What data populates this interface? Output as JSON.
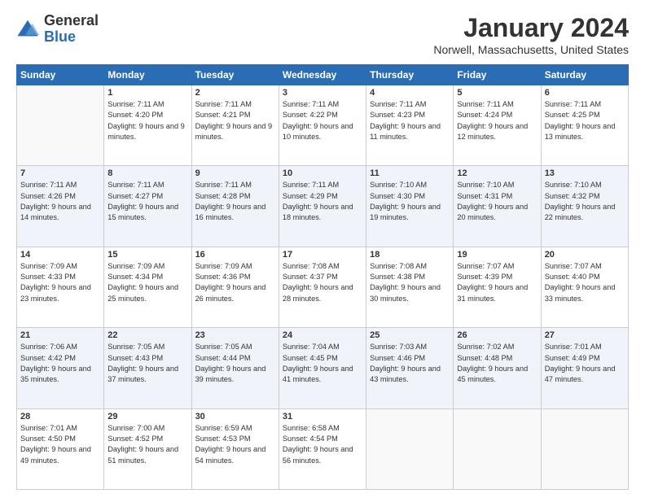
{
  "header": {
    "logo_general": "General",
    "logo_blue": "Blue",
    "month_year": "January 2024",
    "location": "Norwell, Massachusetts, United States"
  },
  "days_of_week": [
    "Sunday",
    "Monday",
    "Tuesday",
    "Wednesday",
    "Thursday",
    "Friday",
    "Saturday"
  ],
  "weeks": [
    [
      {
        "day": "",
        "sunrise": "",
        "sunset": "",
        "daylight": "",
        "empty": true
      },
      {
        "day": "1",
        "sunrise": "Sunrise: 7:11 AM",
        "sunset": "Sunset: 4:20 PM",
        "daylight": "Daylight: 9 hours and 9 minutes.",
        "empty": false
      },
      {
        "day": "2",
        "sunrise": "Sunrise: 7:11 AM",
        "sunset": "Sunset: 4:21 PM",
        "daylight": "Daylight: 9 hours and 9 minutes.",
        "empty": false
      },
      {
        "day": "3",
        "sunrise": "Sunrise: 7:11 AM",
        "sunset": "Sunset: 4:22 PM",
        "daylight": "Daylight: 9 hours and 10 minutes.",
        "empty": false
      },
      {
        "day": "4",
        "sunrise": "Sunrise: 7:11 AM",
        "sunset": "Sunset: 4:23 PM",
        "daylight": "Daylight: 9 hours and 11 minutes.",
        "empty": false
      },
      {
        "day": "5",
        "sunrise": "Sunrise: 7:11 AM",
        "sunset": "Sunset: 4:24 PM",
        "daylight": "Daylight: 9 hours and 12 minutes.",
        "empty": false
      },
      {
        "day": "6",
        "sunrise": "Sunrise: 7:11 AM",
        "sunset": "Sunset: 4:25 PM",
        "daylight": "Daylight: 9 hours and 13 minutes.",
        "empty": false
      }
    ],
    [
      {
        "day": "7",
        "sunrise": "Sunrise: 7:11 AM",
        "sunset": "Sunset: 4:26 PM",
        "daylight": "Daylight: 9 hours and 14 minutes.",
        "empty": false
      },
      {
        "day": "8",
        "sunrise": "Sunrise: 7:11 AM",
        "sunset": "Sunset: 4:27 PM",
        "daylight": "Daylight: 9 hours and 15 minutes.",
        "empty": false
      },
      {
        "day": "9",
        "sunrise": "Sunrise: 7:11 AM",
        "sunset": "Sunset: 4:28 PM",
        "daylight": "Daylight: 9 hours and 16 minutes.",
        "empty": false
      },
      {
        "day": "10",
        "sunrise": "Sunrise: 7:11 AM",
        "sunset": "Sunset: 4:29 PM",
        "daylight": "Daylight: 9 hours and 18 minutes.",
        "empty": false
      },
      {
        "day": "11",
        "sunrise": "Sunrise: 7:10 AM",
        "sunset": "Sunset: 4:30 PM",
        "daylight": "Daylight: 9 hours and 19 minutes.",
        "empty": false
      },
      {
        "day": "12",
        "sunrise": "Sunrise: 7:10 AM",
        "sunset": "Sunset: 4:31 PM",
        "daylight": "Daylight: 9 hours and 20 minutes.",
        "empty": false
      },
      {
        "day": "13",
        "sunrise": "Sunrise: 7:10 AM",
        "sunset": "Sunset: 4:32 PM",
        "daylight": "Daylight: 9 hours and 22 minutes.",
        "empty": false
      }
    ],
    [
      {
        "day": "14",
        "sunrise": "Sunrise: 7:09 AM",
        "sunset": "Sunset: 4:33 PM",
        "daylight": "Daylight: 9 hours and 23 minutes.",
        "empty": false
      },
      {
        "day": "15",
        "sunrise": "Sunrise: 7:09 AM",
        "sunset": "Sunset: 4:34 PM",
        "daylight": "Daylight: 9 hours and 25 minutes.",
        "empty": false
      },
      {
        "day": "16",
        "sunrise": "Sunrise: 7:09 AM",
        "sunset": "Sunset: 4:36 PM",
        "daylight": "Daylight: 9 hours and 26 minutes.",
        "empty": false
      },
      {
        "day": "17",
        "sunrise": "Sunrise: 7:08 AM",
        "sunset": "Sunset: 4:37 PM",
        "daylight": "Daylight: 9 hours and 28 minutes.",
        "empty": false
      },
      {
        "day": "18",
        "sunrise": "Sunrise: 7:08 AM",
        "sunset": "Sunset: 4:38 PM",
        "daylight": "Daylight: 9 hours and 30 minutes.",
        "empty": false
      },
      {
        "day": "19",
        "sunrise": "Sunrise: 7:07 AM",
        "sunset": "Sunset: 4:39 PM",
        "daylight": "Daylight: 9 hours and 31 minutes.",
        "empty": false
      },
      {
        "day": "20",
        "sunrise": "Sunrise: 7:07 AM",
        "sunset": "Sunset: 4:40 PM",
        "daylight": "Daylight: 9 hours and 33 minutes.",
        "empty": false
      }
    ],
    [
      {
        "day": "21",
        "sunrise": "Sunrise: 7:06 AM",
        "sunset": "Sunset: 4:42 PM",
        "daylight": "Daylight: 9 hours and 35 minutes.",
        "empty": false
      },
      {
        "day": "22",
        "sunrise": "Sunrise: 7:05 AM",
        "sunset": "Sunset: 4:43 PM",
        "daylight": "Daylight: 9 hours and 37 minutes.",
        "empty": false
      },
      {
        "day": "23",
        "sunrise": "Sunrise: 7:05 AM",
        "sunset": "Sunset: 4:44 PM",
        "daylight": "Daylight: 9 hours and 39 minutes.",
        "empty": false
      },
      {
        "day": "24",
        "sunrise": "Sunrise: 7:04 AM",
        "sunset": "Sunset: 4:45 PM",
        "daylight": "Daylight: 9 hours and 41 minutes.",
        "empty": false
      },
      {
        "day": "25",
        "sunrise": "Sunrise: 7:03 AM",
        "sunset": "Sunset: 4:46 PM",
        "daylight": "Daylight: 9 hours and 43 minutes.",
        "empty": false
      },
      {
        "day": "26",
        "sunrise": "Sunrise: 7:02 AM",
        "sunset": "Sunset: 4:48 PM",
        "daylight": "Daylight: 9 hours and 45 minutes.",
        "empty": false
      },
      {
        "day": "27",
        "sunrise": "Sunrise: 7:01 AM",
        "sunset": "Sunset: 4:49 PM",
        "daylight": "Daylight: 9 hours and 47 minutes.",
        "empty": false
      }
    ],
    [
      {
        "day": "28",
        "sunrise": "Sunrise: 7:01 AM",
        "sunset": "Sunset: 4:50 PM",
        "daylight": "Daylight: 9 hours and 49 minutes.",
        "empty": false
      },
      {
        "day": "29",
        "sunrise": "Sunrise: 7:00 AM",
        "sunset": "Sunset: 4:52 PM",
        "daylight": "Daylight: 9 hours and 51 minutes.",
        "empty": false
      },
      {
        "day": "30",
        "sunrise": "Sunrise: 6:59 AM",
        "sunset": "Sunset: 4:53 PM",
        "daylight": "Daylight: 9 hours and 54 minutes.",
        "empty": false
      },
      {
        "day": "31",
        "sunrise": "Sunrise: 6:58 AM",
        "sunset": "Sunset: 4:54 PM",
        "daylight": "Daylight: 9 hours and 56 minutes.",
        "empty": false
      },
      {
        "day": "",
        "sunrise": "",
        "sunset": "",
        "daylight": "",
        "empty": true
      },
      {
        "day": "",
        "sunrise": "",
        "sunset": "",
        "daylight": "",
        "empty": true
      },
      {
        "day": "",
        "sunrise": "",
        "sunset": "",
        "daylight": "",
        "empty": true
      }
    ]
  ]
}
